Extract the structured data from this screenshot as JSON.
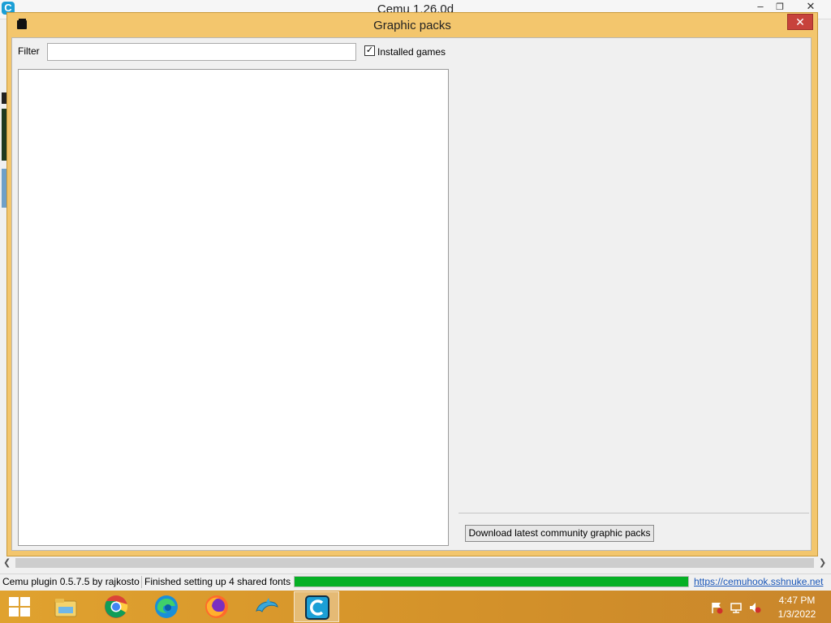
{
  "main_window": {
    "title": "Cemu 1.26.0d",
    "app_icon": "C"
  },
  "dialog": {
    "title": "Graphic packs",
    "filter_label": "Filter",
    "filter_value": "",
    "installed_games_label": "Installed games",
    "installed_games_checked": true,
    "download_button": "Download latest community graphic packs"
  },
  "statusbar": {
    "plugin": "Cemu plugin 0.5.7.5 by rajkosto",
    "fonts": "Finished setting up 4 shared fonts",
    "progress": 1.0,
    "link": "https://cemuhook.sshnuke.net"
  },
  "taskbar": {
    "apps": [
      {
        "icon": "file-explorer-icon",
        "active": false
      },
      {
        "icon": "chrome-icon",
        "active": false
      },
      {
        "icon": "edge-icon",
        "active": false
      },
      {
        "icon": "firefox-icon",
        "active": false
      },
      {
        "icon": "dolphin-icon",
        "active": false
      },
      {
        "icon": "cemu-icon",
        "active": true
      }
    ],
    "tray_icons": [
      "action-center-flag-icon",
      "network-icon",
      "volume-muted-icon"
    ],
    "time": "4:47 PM",
    "date": "1/3/2022"
  },
  "colors": {
    "dialog_frame": "#f3c66d",
    "close_button": "#c7423b",
    "progress_fill": "#06b025",
    "taskbar": "#d4922a",
    "link": "#1a57b9"
  }
}
